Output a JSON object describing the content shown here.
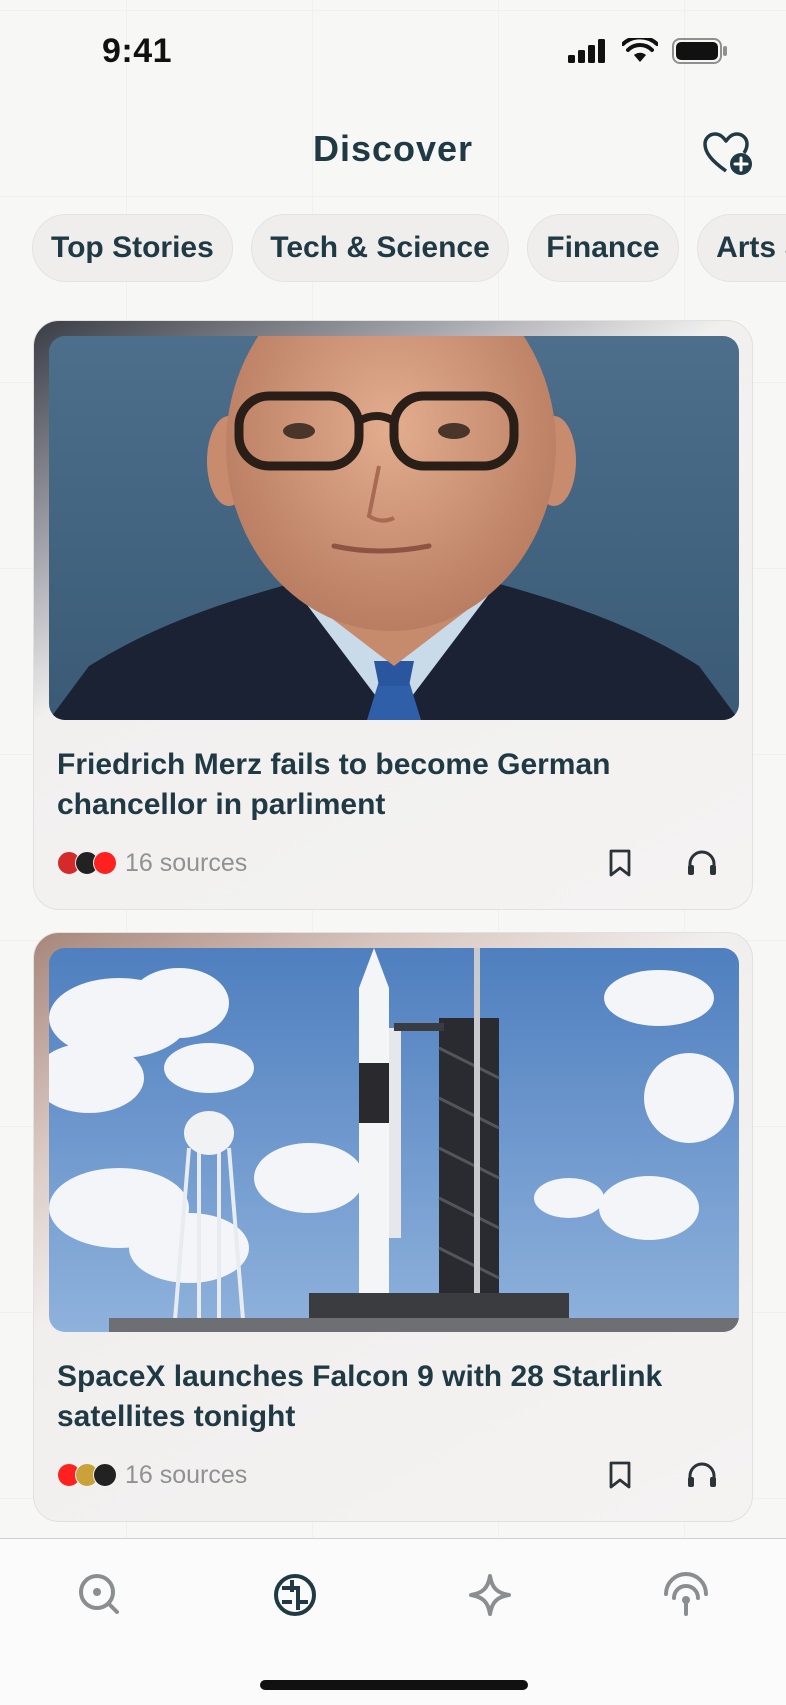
{
  "status_bar": {
    "time": "9:41"
  },
  "header": {
    "title": "Discover"
  },
  "tabs": [
    {
      "label": "Top Stories"
    },
    {
      "label": "Tech & Science"
    },
    {
      "label": "Finance"
    },
    {
      "label": "Arts & Culture"
    }
  ],
  "cards": [
    {
      "title": "Friedrich Merz fails to become German chancellor in parliment",
      "sources": "16 sources",
      "image": "portrait of Friedrich Merz"
    },
    {
      "title": "SpaceX launches Falcon 9 with 28 Starlink satellites tonight",
      "sources": "16 sources",
      "image": "Falcon 9 rocket on launch pad"
    }
  ],
  "bottom_nav": [
    {
      "icon": "search-icon"
    },
    {
      "icon": "discover-icon",
      "active": true
    },
    {
      "icon": "spaces-icon"
    },
    {
      "icon": "library-icon"
    }
  ],
  "colors": {
    "accent": "#1f3a44",
    "background": "#f7f7f6",
    "muted": "#8f9193"
  }
}
